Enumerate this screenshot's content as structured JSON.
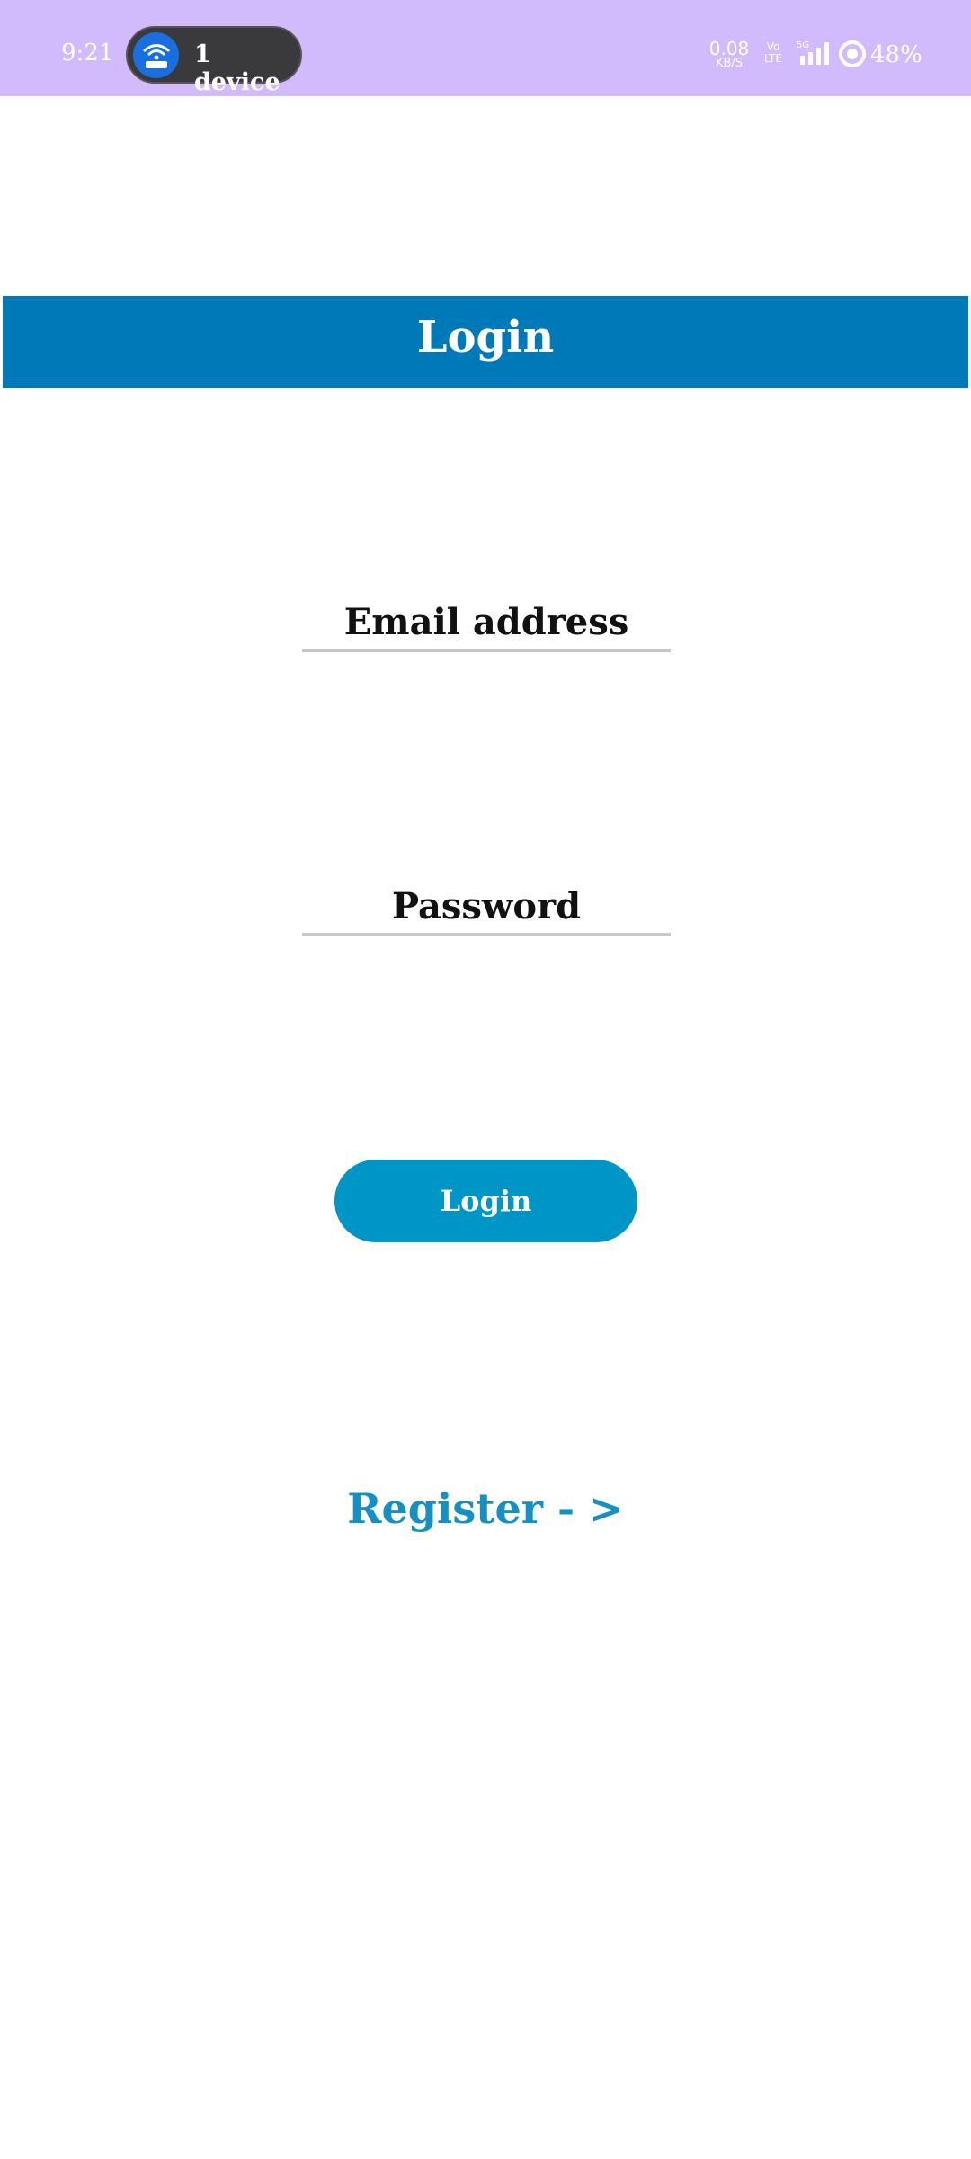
{
  "status_bar": {
    "time": "9:21",
    "device_label": "1 device",
    "net_speed": "0.08",
    "net_unit": "KB/S",
    "volte_top": "Vo",
    "volte_bottom": "LTE",
    "network": "5G",
    "battery": "48%",
    "background_color": "#d1bbfc"
  },
  "header": {
    "title": "Login",
    "color": "#0079b9"
  },
  "form": {
    "email_label": "Email address",
    "password_label": "Password",
    "login_button_label": "Login",
    "register_link_label": "Register - >"
  },
  "colors": {
    "button": "#0095c7",
    "link": "#1490c4"
  },
  "icons": {
    "device": "hotspot-icon",
    "signal": "signal-icon",
    "battery": "battery-icon"
  }
}
